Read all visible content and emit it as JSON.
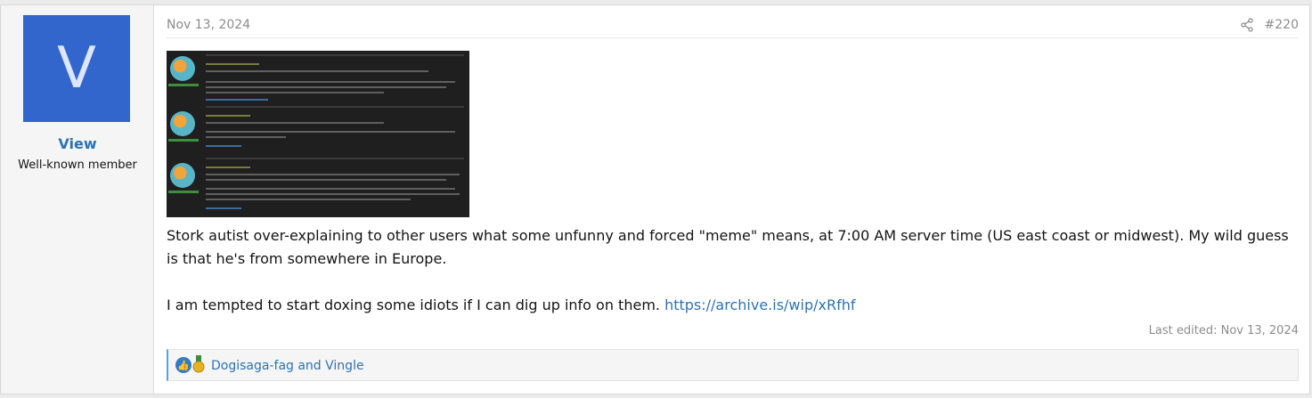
{
  "user": {
    "avatar_letter": "V",
    "name": "View",
    "title": "Well-known member",
    "avatar_color": "#3366cc"
  },
  "post": {
    "date": "Nov 13, 2024",
    "number": "#220",
    "share_icon": "share-icon",
    "paragraph1": "Stork autist over-explaining to other users what some unfunny and forced \"meme\" means, at 7:00 AM server time (US east coast or midwest). My wild guess is that he's from somewhere in Europe.",
    "paragraph2_text": "I am tempted to start doxing some idiots if I can dig up info on them. ",
    "paragraph2_link": "https://archive.is/wip/xRfhf",
    "last_edited": "Last edited: Nov 13, 2024",
    "link_color": "#2b73b4"
  },
  "reactions": {
    "users": "Dogisaga-fag and Vingle",
    "icons": [
      "like-icon",
      "medal-icon"
    ]
  }
}
